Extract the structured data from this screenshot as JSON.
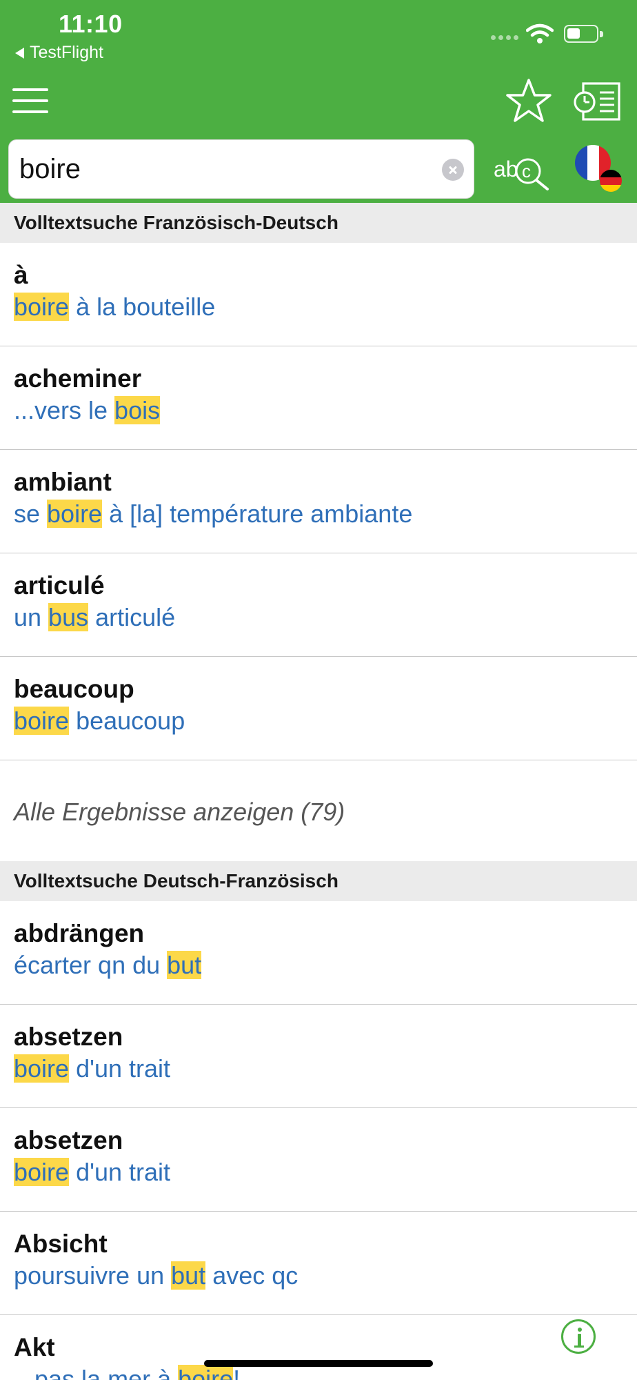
{
  "status_bar": {
    "time": "11:10",
    "back_app": "TestFlight"
  },
  "toolbar": {
    "menu_icon": "hamburger-menu-icon",
    "favorites_icon": "star-icon",
    "history_icon": "history-list-icon",
    "spell_icon": "spell-search-icon",
    "language_icon": "fr-de-flags-icon"
  },
  "search": {
    "value": "boire"
  },
  "sections": [
    {
      "title": "Volltextsuche Französisch-Deutsch",
      "entries": [
        {
          "headword": "à",
          "pre": "",
          "hit": "boire",
          "post": " à la bouteille"
        },
        {
          "headword": "acheminer",
          "pre": "...vers le ",
          "hit": "bois",
          "post": ""
        },
        {
          "headword": "ambiant",
          "pre": "se ",
          "hit": "boire",
          "post": " à [la] température ambiante"
        },
        {
          "headword": "articulé",
          "pre": "un ",
          "hit": "bus",
          "post": " articulé"
        },
        {
          "headword": "beaucoup",
          "pre": "",
          "hit": "boire",
          "post": " beaucoup"
        }
      ],
      "show_all": "Alle Ergebnisse anzeigen (79)"
    },
    {
      "title": "Volltextsuche Deutsch-Französisch",
      "entries": [
        {
          "headword": "abdrängen",
          "pre": "écarter qn du ",
          "hit": "but",
          "post": ""
        },
        {
          "headword": "absetzen",
          "pre": "",
          "hit": "boire",
          "post": " d'un trait"
        },
        {
          "headword": "absetzen",
          "pre": "",
          "hit": "boire",
          "post": " d'un trait"
        },
        {
          "headword": "Absicht",
          "pre": "poursuivre un ",
          "hit": "but",
          "post": " avec qc"
        },
        {
          "headword": "Akt",
          "pre": "...pas la mer à ",
          "hit": "boire",
          "post": "!"
        }
      ]
    }
  ],
  "colors": {
    "brand_green": "#4caf42",
    "highlight": "#fcd849",
    "example_blue": "#2f6fb8"
  }
}
